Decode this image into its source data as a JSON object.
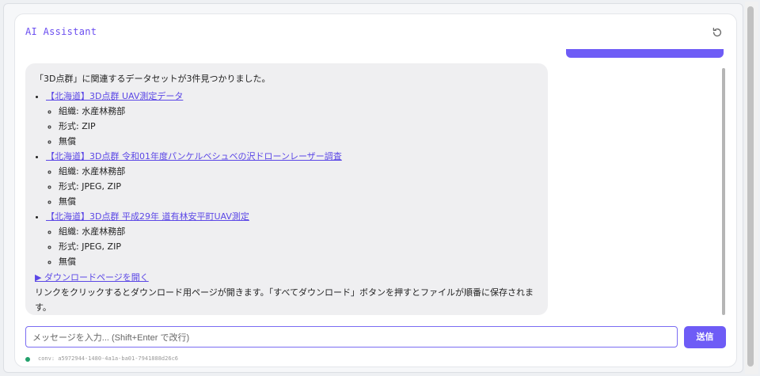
{
  "app": {
    "title": "AI Assistant"
  },
  "colors": {
    "accent": "#6e5cf6",
    "status_connected": "#22a06b",
    "link": "#5b47e6"
  },
  "icons": {
    "reset": "refresh-icon"
  },
  "message": {
    "intro": "「3D点群」に関連するデータセットが3件見つかりました。",
    "datasets": [
      {
        "title": "【北海道】3D点群 UAV測定データ",
        "org": "組織: 水産林務部",
        "format": "形式: ZIP",
        "price": "無償"
      },
      {
        "title": "【北海道】3D点群 令和01年度パンケルベシュベの沢ドローンレーザー調査",
        "org": "組織: 水産林務部",
        "format": "形式: JPEG, ZIP",
        "price": "無償"
      },
      {
        "title": "【北海道】3D点群 平成29年 道有林安平町UAV測定",
        "org": "組織: 水産林務部",
        "format": "形式: JPEG, ZIP",
        "price": "無償"
      }
    ],
    "download_link": "▶ ダウンロードページを開く",
    "note": "リンクをクリックするとダウンロード用ページが開きます。「すべてダウンロード」ボタンを押すとファイルが順番に保存されます。"
  },
  "input": {
    "placeholder": "メッセージを入力... (Shift+Enter で改行)"
  },
  "send_label": "送信",
  "conversation_id": "conv: a5972944-1480-4a1a-ba01-7941888d26c6"
}
